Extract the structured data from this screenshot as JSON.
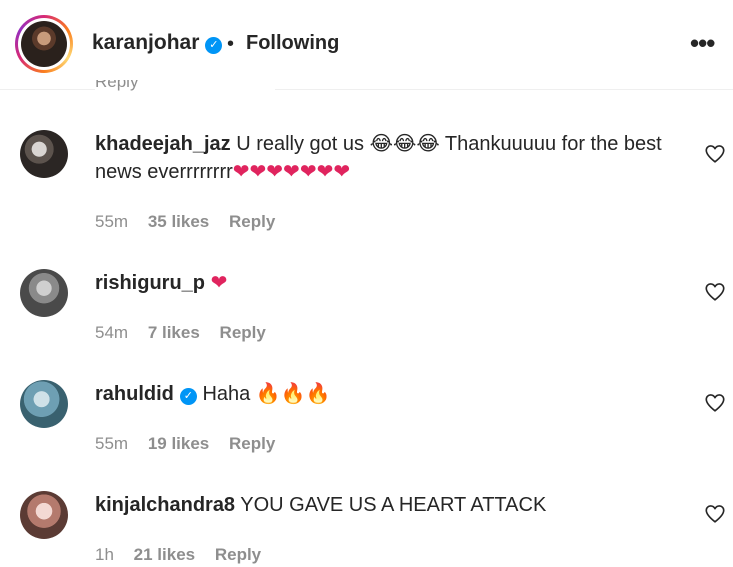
{
  "header": {
    "username": "karanjohar",
    "separator": "•",
    "follow_status": "Following",
    "more_label": "•••"
  },
  "partial_text": "Reply",
  "comments": [
    {
      "username": "khadeejah_jaz",
      "text": "U really got us 😂😂😂 Thankuuuuu for the best news everrrrrrrr",
      "trailing": "❤❤❤❤❤❤❤",
      "time": "55m",
      "likes": "35 likes",
      "reply": "Reply"
    },
    {
      "username": "rishiguru_p",
      "text": "",
      "trailing": "❤",
      "time": "54m",
      "likes": "7 likes",
      "reply": "Reply"
    },
    {
      "username": "rahuldid",
      "text": "Haha 🔥🔥🔥",
      "trailing": "",
      "time": "55m",
      "likes": "19 likes",
      "reply": "Reply"
    },
    {
      "username": "kinjalchandra8",
      "text": "YOU GAVE US A HEART ATTACK",
      "trailing": "",
      "time": "1h",
      "likes": "21 likes",
      "reply": "Reply"
    }
  ],
  "icons": {
    "verified": "verified-badge-icon",
    "like": "heart-outline-icon",
    "more": "more-options-icon"
  },
  "colors": {
    "verified": "#0095f6",
    "meta": "#8e8e8e",
    "text": "#262626",
    "heart": "#e0245e"
  }
}
